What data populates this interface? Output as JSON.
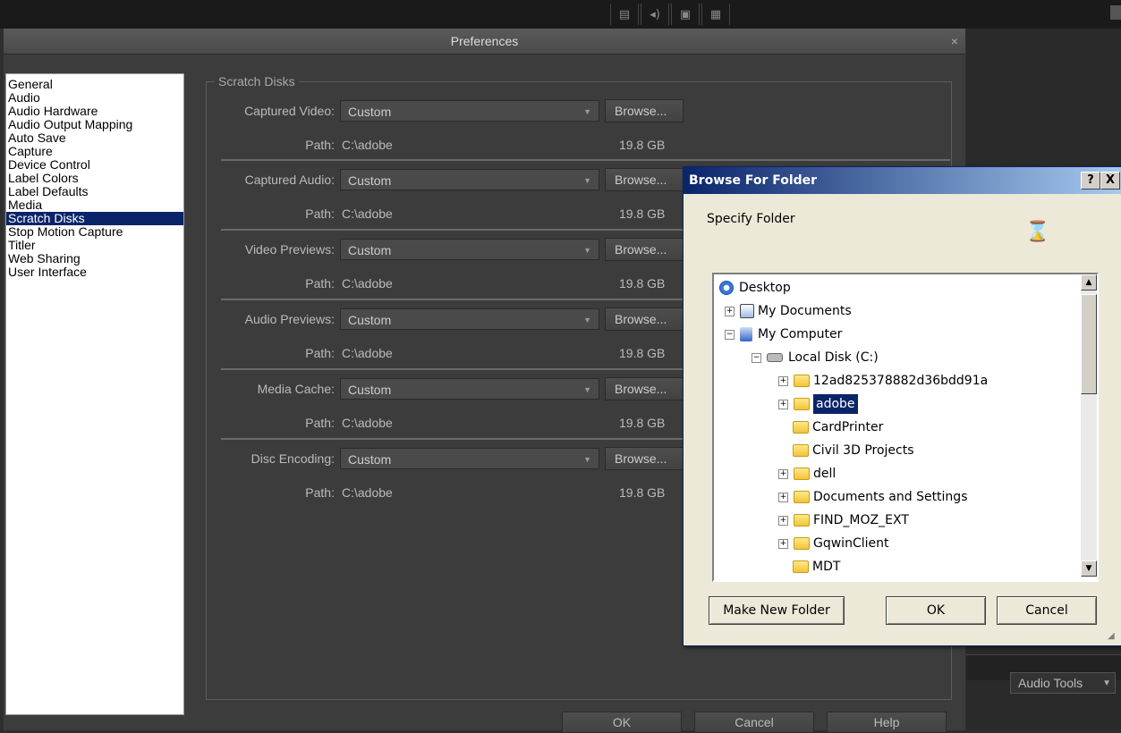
{
  "prefs": {
    "title": "Preferences",
    "close": "×",
    "categories": [
      {
        "label": "General"
      },
      {
        "label": "Audio"
      },
      {
        "label": "Audio Hardware"
      },
      {
        "label": "Audio Output Mapping"
      },
      {
        "label": "Auto Save"
      },
      {
        "label": "Capture"
      },
      {
        "label": "Device Control"
      },
      {
        "label": "Label Colors"
      },
      {
        "label": "Label Defaults"
      },
      {
        "label": "Media"
      },
      {
        "label": "Scratch Disks"
      },
      {
        "label": "Stop Motion Capture"
      },
      {
        "label": "Titler"
      },
      {
        "label": "Web Sharing"
      },
      {
        "label": "User Interface"
      }
    ],
    "selected_category": "Scratch Disks",
    "group_label": "Scratch Disks",
    "rows": [
      {
        "label": "Captured Video:",
        "value": "Custom",
        "browse": "Browse...",
        "path_label": "Path:",
        "path": "C:\\adobe",
        "size": "19.8 GB"
      },
      {
        "label": "Captured Audio:",
        "value": "Custom",
        "browse": "Browse...",
        "path_label": "Path:",
        "path": "C:\\adobe",
        "size": "19.8 GB"
      },
      {
        "label": "Video Previews:",
        "value": "Custom",
        "browse": "Browse...",
        "path_label": "Path:",
        "path": "C:\\adobe",
        "size": "19.8 GB"
      },
      {
        "label": "Audio Previews:",
        "value": "Custom",
        "browse": "Browse...",
        "path_label": "Path:",
        "path": "C:\\adobe",
        "size": "19.8 GB"
      },
      {
        "label": "Media Cache:",
        "value": "Custom",
        "browse": "Browse...",
        "path_label": "Path:",
        "path": "C:\\adobe",
        "size": "19.8 GB"
      },
      {
        "label": "Disc Encoding:",
        "value": "Custom",
        "browse": "Browse...",
        "path_label": "Path:",
        "path": "C:\\adobe",
        "size": "19.8 GB"
      }
    ],
    "buttons": {
      "ok": "OK",
      "cancel": "Cancel",
      "help": "Help"
    }
  },
  "right_panel": {
    "audio_tools": "Audio Tools"
  },
  "browse_dialog": {
    "title": "Browse For Folder",
    "help_btn": "?",
    "close_btn": "X",
    "instruction": "Specify Folder",
    "tree": [
      {
        "label": "Desktop",
        "icon": "desktop-icon"
      },
      {
        "label": "My Documents",
        "icon": "documents-icon"
      },
      {
        "label": "My Computer",
        "icon": "computer-icon"
      },
      {
        "label": "Local Disk (C:)",
        "icon": "drive-icon"
      },
      {
        "label": "12ad825378882d36bdd91a",
        "icon": "folder-icon"
      },
      {
        "label": "adobe",
        "icon": "folder-icon"
      },
      {
        "label": "CardPrinter",
        "icon": "folder-icon"
      },
      {
        "label": "Civil 3D Projects",
        "icon": "folder-icon"
      },
      {
        "label": "dell",
        "icon": "folder-icon"
      },
      {
        "label": "Documents and Settings",
        "icon": "folder-icon"
      },
      {
        "label": "FIND_MOZ_EXT",
        "icon": "folder-icon"
      },
      {
        "label": "GqwinClient",
        "icon": "folder-icon"
      },
      {
        "label": "MDT",
        "icon": "folder-icon"
      }
    ],
    "selected": "adobe",
    "buttons": {
      "make_new_folder": "Make New Folder",
      "ok": "OK",
      "cancel": "Cancel"
    }
  }
}
